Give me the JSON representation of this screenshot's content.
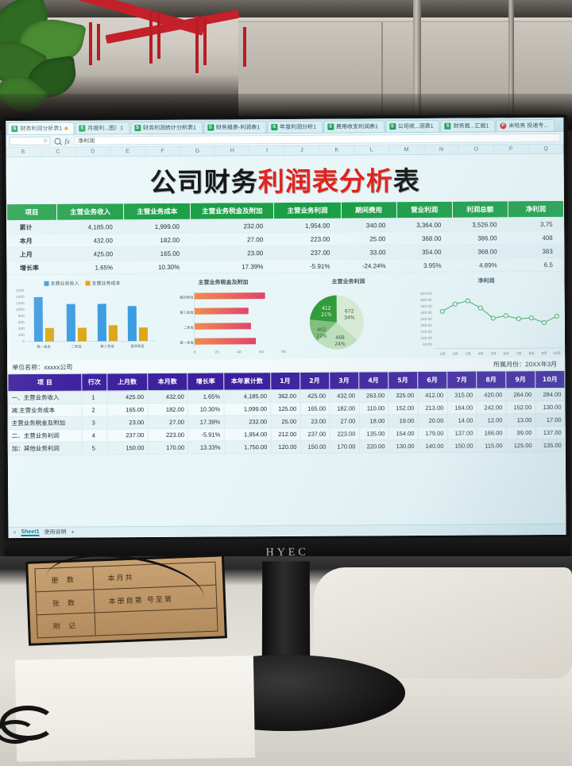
{
  "photo": {
    "monitor_brand": "HYEC",
    "folder_rows": [
      {
        "label": "册 数",
        "value": "本月共"
      },
      {
        "label": "张 数",
        "value": "本册自第          号至第"
      },
      {
        "label": "附 记",
        "value": ""
      }
    ]
  },
  "app": {
    "tabs": [
      {
        "label": "财务利润分析表1",
        "icon": "excel-icon",
        "active": true,
        "modified": true
      },
      {
        "label": "月报利...图）1",
        "icon": "excel-icon",
        "active": false
      },
      {
        "label": "财务利润统计分析表1",
        "icon": "excel-icon",
        "active": false
      },
      {
        "label": "财务报表-利润表1",
        "icon": "excel-icon",
        "active": false
      },
      {
        "label": "年度利润分析1",
        "icon": "excel-icon",
        "active": false
      },
      {
        "label": "费用收支利润表1",
        "icon": "excel-icon",
        "active": false
      },
      {
        "label": "公司收...润表1",
        "icon": "excel-icon",
        "active": false
      },
      {
        "label": "财务报...汇报1",
        "icon": "excel-icon",
        "active": false
      },
      {
        "label": "米哈亮 投递专...",
        "icon": "pdf-icon",
        "active": false
      }
    ],
    "namebox": "D",
    "formula_value": "净利润",
    "column_headers": [
      "B",
      "C",
      "D",
      "E",
      "F",
      "G",
      "H",
      "I",
      "J",
      "K",
      "L",
      "M",
      "N",
      "O",
      "P",
      "Q"
    ],
    "sheet_tabs": [
      "Sheet1",
      "使用说明"
    ],
    "add_sheet_label": "+",
    "close_label": "×"
  },
  "doc": {
    "title_black_1": "公司财务",
    "title_red": "利润表分析",
    "title_black_2": "表",
    "summary": {
      "headers": [
        "项目",
        "主营业务收入",
        "主营业务成本",
        "主营业务税金及附加",
        "主营业务利润",
        "期间费用",
        "营业利润",
        "利润总额",
        "净利润"
      ],
      "rows": [
        {
          "label": "累计",
          "values": [
            "4,185.00",
            "1,999.00",
            "232.00",
            "1,954.00",
            "340.00",
            "3,364.00",
            "3,526.00",
            "3,75"
          ]
        },
        {
          "label": "本月",
          "values": [
            "432.00",
            "182.00",
            "27.00",
            "223.00",
            "25.00",
            "368.00",
            "386.00",
            "408"
          ]
        },
        {
          "label": "上月",
          "values": [
            "425.00",
            "165.00",
            "23.00",
            "237.00",
            "33.00",
            "354.00",
            "368.00",
            "383"
          ]
        },
        {
          "label": "增长率",
          "values": [
            "1.65%",
            "10.30%",
            "17.39%",
            "-5.91%",
            "-24.24%",
            "3.95%",
            "4.89%",
            "6.5"
          ]
        }
      ]
    },
    "meta": {
      "company_label": "单位名称：",
      "company_value": "xxxxx公司",
      "period_label": "所属月份：",
      "period_value": "20XX年3月"
    },
    "detail": {
      "headers": [
        "项      目",
        "行次",
        "上月数",
        "本月数",
        "增长率",
        "本年累计数",
        "1月",
        "2月",
        "3月",
        "4月",
        "5月",
        "6月",
        "7月",
        "8月",
        "9月",
        "10月"
      ],
      "rows": [
        {
          "cells": [
            "一、主营业务收入",
            "1",
            "425.00",
            "432.00",
            "1.65%",
            "4,185.00",
            "362.00",
            "425.00",
            "432.00",
            "263.00",
            "325.00",
            "412.00",
            "315.00",
            "420.00",
            "264.00",
            "284.00"
          ]
        },
        {
          "cells": [
            "减:主营业务成本",
            "2",
            "165.00",
            "182.00",
            "10.30%",
            "1,999.00",
            "125.00",
            "165.00",
            "182.00",
            "110.00",
            "152.00",
            "213.00",
            "164.00",
            "242.00",
            "152.00",
            "130.00"
          ]
        },
        {
          "cells": [
            "主营业务税金及附加",
            "3",
            "23.00",
            "27.00",
            "17.39%",
            "232.00",
            "25.00",
            "23.00",
            "27.00",
            "18.00",
            "19.00",
            "20.00",
            "14.00",
            "12.00",
            "13.00",
            "17.00"
          ]
        },
        {
          "cells": [
            "二、主营业务利润",
            "4",
            "237.00",
            "223.00",
            "-5.91%",
            "1,954.00",
            "212.00",
            "237.00",
            "223.00",
            "135.00",
            "154.00",
            "179.00",
            "137.00",
            "166.00",
            "99.00",
            "137.00"
          ]
        },
        {
          "cells": [
            "加：其他业务利润",
            "5",
            "150.00",
            "170.00",
            "13.33%",
            "1,750.00",
            "120.00",
            "150.00",
            "170.00",
            "220.00",
            "130.00",
            "140.00",
            "150.00",
            "115.00",
            "125.00",
            "135.00"
          ]
        }
      ]
    }
  },
  "chart_data": [
    {
      "type": "bar",
      "title": "",
      "categories": [
        "第一季度",
        "二季度",
        "第三季度",
        "第四季度"
      ],
      "series": [
        {
          "name": "主营业务收入",
          "color": "#3b9ae1",
          "values": [
            1380,
            1170,
            1165,
            1115
          ]
        },
        {
          "name": "主营业务成本",
          "color": "#e0a017",
          "values": [
            420,
            420,
            500,
            430
          ]
        }
      ],
      "ylim": [
        0,
        1600
      ],
      "yticks": [
        "0",
        "200",
        "400",
        "600",
        "800",
        "1000",
        "1200",
        "1400",
        "1600"
      ],
      "legend": "top",
      "grid": false
    },
    {
      "type": "bar",
      "orientation": "horizontal",
      "title": "主营业务税金及附加",
      "categories": [
        "第一季度",
        "二季度",
        "第三季度",
        "第四季度"
      ],
      "values": [
        73,
        56,
        58,
        63
      ],
      "xlim": [
        0,
        80
      ],
      "xticks": [
        "0",
        "20",
        "40",
        "60",
        "80"
      ],
      "color_start": "#ef8b4e",
      "color_end": "#e0446b",
      "grid": false
    },
    {
      "type": "pie",
      "title": "主营业务利润",
      "labels": [
        "672",
        "468",
        "402",
        "412"
      ],
      "values": [
        672,
        468,
        402,
        412
      ],
      "percents": [
        "34%",
        "24%",
        "21%",
        "21%"
      ],
      "colors": [
        "#d6ecd4",
        "#bfe0bb",
        "#7fc07a",
        "#2e9a36"
      ]
    },
    {
      "type": "line",
      "title": "净利润",
      "x": [
        "1月",
        "2月",
        "3月",
        "4月",
        "5月",
        "6月",
        "7月",
        "8月",
        "9月",
        "10月"
      ],
      "values": [
        325,
        382,
        408,
        348,
        277,
        298,
        275,
        283,
        238,
        292
      ],
      "ylim": [
        0,
        450
      ],
      "yticks": [
        "450.00",
        "400.00",
        "350.00",
        "300.00",
        "250.00",
        "200.00",
        "150.00",
        "100.00",
        "50.00"
      ],
      "color": "#35a65a",
      "grid": false
    }
  ]
}
